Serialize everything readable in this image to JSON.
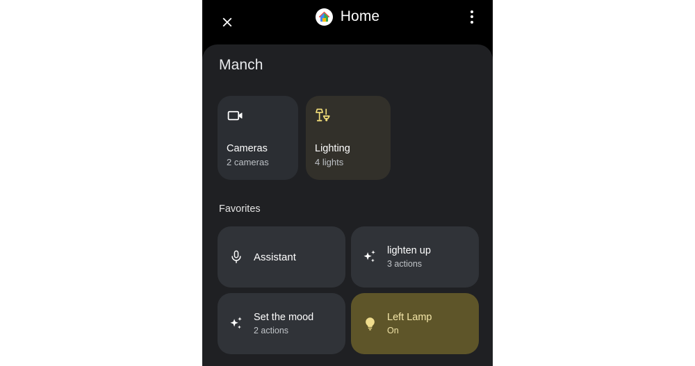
{
  "appbar": {
    "close_icon": "close-icon",
    "logo_icon": "google-home-logo-icon",
    "title": "Home",
    "overflow_icon": "more-vert-icon"
  },
  "sheet": {
    "home_name": "Manch"
  },
  "categories": [
    {
      "icon": "videocam-icon",
      "title": "Cameras",
      "subtitle": "2 cameras",
      "tinted": false
    },
    {
      "icon": "lamps-icon",
      "title": "Lighting",
      "subtitle": "4 lights",
      "tinted": true
    }
  ],
  "favorites": {
    "label": "Favorites",
    "items": [
      {
        "icon": "microphone-icon",
        "title": "Assistant",
        "subtitle": "",
        "active": false
      },
      {
        "icon": "sparkles-icon",
        "title": "lighten up",
        "subtitle": "3 actions",
        "active": false
      },
      {
        "icon": "sparkles-icon",
        "title": "Set the mood",
        "subtitle": "2 actions",
        "active": false
      },
      {
        "icon": "lightbulb-icon",
        "title": "Left Lamp",
        "subtitle": "On",
        "active": true
      }
    ]
  },
  "colors": {
    "page_background": "#ffffff",
    "appbar_background": "#000000",
    "sheet_background": "#1f2023",
    "card_background": "#303338",
    "card_tinted_background": "#32302a",
    "active_card_background": "#5e5529",
    "accent_yellow": "#f5e07a",
    "primary_text": "#ffffff",
    "secondary_text": "#bdc1c6"
  }
}
